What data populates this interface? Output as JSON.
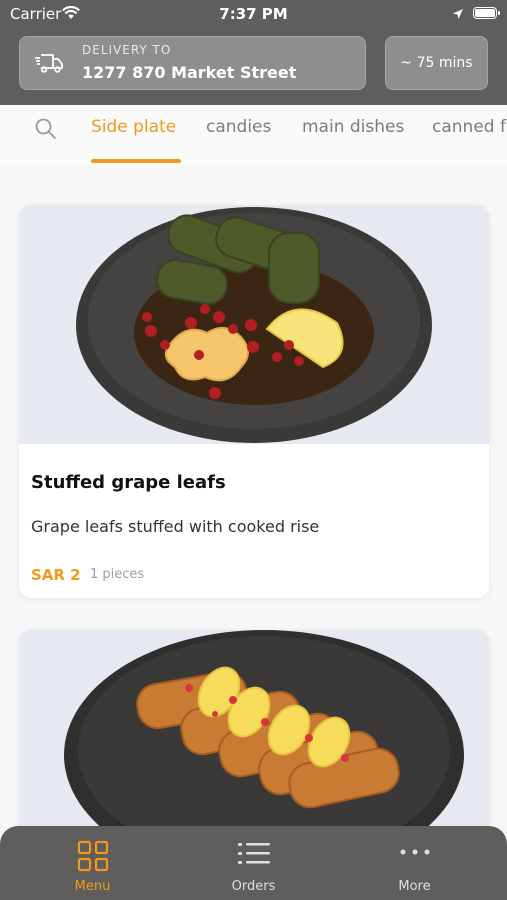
{
  "status_bar": {
    "carrier": "Carrier",
    "time": "7:37 PM"
  },
  "header": {
    "delivery_label": "DELIVERY TO",
    "delivery_address": "1277 870 Market Street",
    "eta": "~ 75 mins"
  },
  "tabs": [
    {
      "label": "Side plate",
      "active": true
    },
    {
      "label": "candies",
      "active": false
    },
    {
      "label": "main dishes",
      "active": false
    },
    {
      "label": "canned fo",
      "active": false
    }
  ],
  "items": [
    {
      "title": "Stuffed grape leafs",
      "description": "Grape leafs stuffed with cooked rise",
      "price": "SAR 2",
      "quantity": "1 pieces"
    }
  ],
  "bottom_nav": [
    {
      "label": "Menu",
      "icon": "grid-icon",
      "active": true
    },
    {
      "label": "Orders",
      "icon": "list-icon",
      "active": false
    },
    {
      "label": "More",
      "icon": "more-icon",
      "active": false
    }
  ],
  "colors": {
    "accent": "#ef9a1b",
    "header_bg": "#5f5e5c"
  }
}
